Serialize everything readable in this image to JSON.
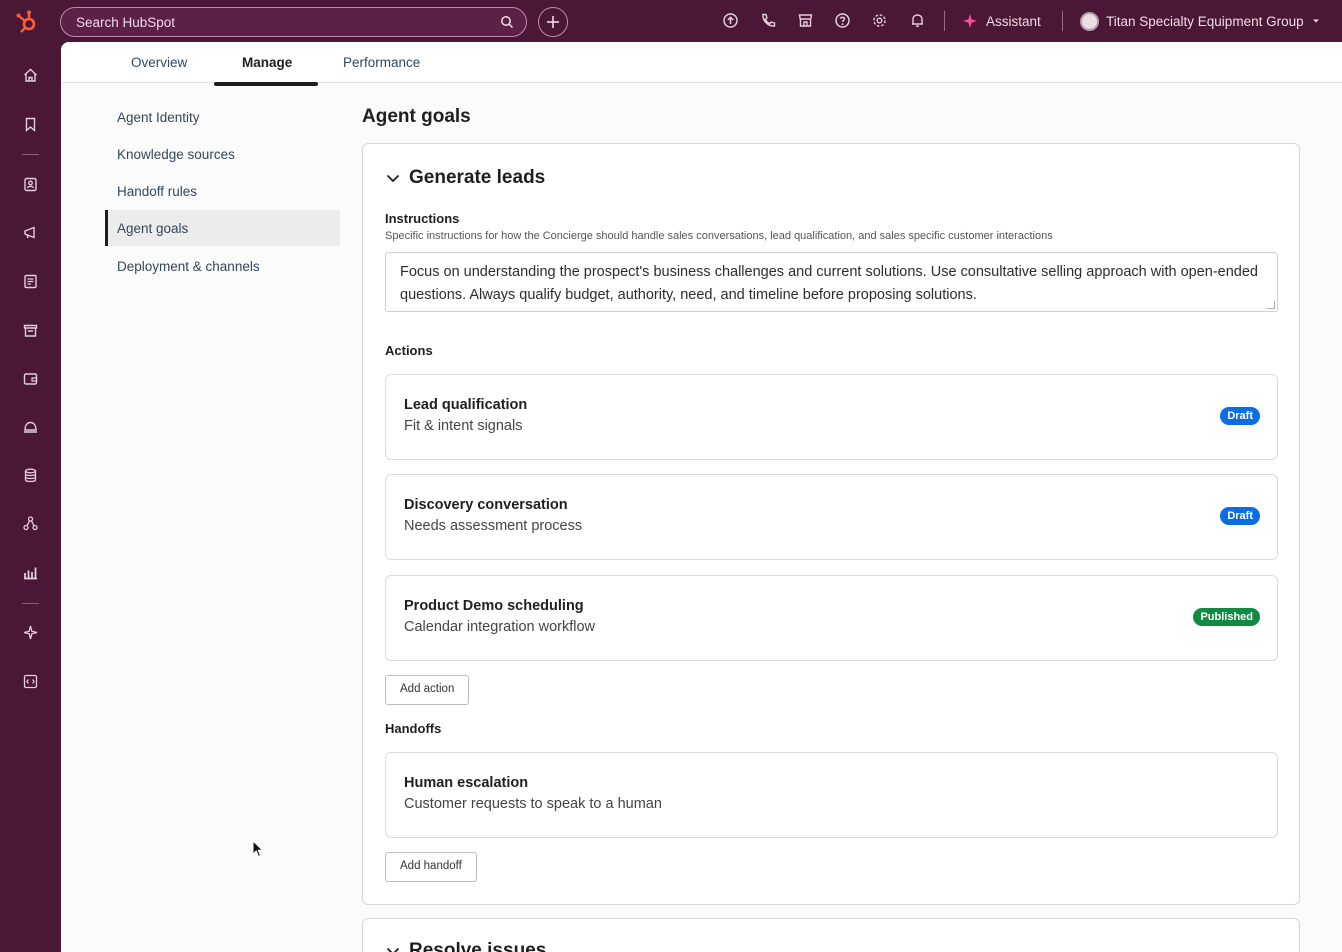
{
  "topbar": {
    "search_placeholder": "Search HubSpot",
    "assistant_label": "Assistant",
    "account_name": "Titan Specialty Equipment Group",
    "icons": [
      "upgrade-icon",
      "phone-icon",
      "marketplace-icon",
      "help-icon",
      "settings-icon",
      "notifications-icon"
    ]
  },
  "tabs": [
    {
      "label": "Overview",
      "active": false
    },
    {
      "label": "Manage",
      "active": true
    },
    {
      "label": "Performance",
      "active": false
    }
  ],
  "sidebar": {
    "items": [
      {
        "label": "Agent Identity",
        "active": false
      },
      {
        "label": "Knowledge sources",
        "active": false
      },
      {
        "label": "Handoff rules",
        "active": false
      },
      {
        "label": "Agent goals",
        "active": true
      },
      {
        "label": "Deployment & channels",
        "active": false
      }
    ]
  },
  "page": {
    "title": "Agent goals"
  },
  "goal": {
    "title": "Generate leads",
    "instructions_label": "Instructions",
    "instructions_help": "Specific instructions for how the Concierge should handle sales conversations, lead qualification, and sales specific customer interactions",
    "instructions_value": "Focus on understanding the prospect's business challenges and current solutions. Use consultative selling approach with open-ended questions. Always qualify budget, authority, need, and timeline before proposing solutions.",
    "actions_label": "Actions",
    "actions": [
      {
        "title": "Lead qualification",
        "subtitle": "Fit & intent signals",
        "status": "Draft"
      },
      {
        "title": "Discovery conversation",
        "subtitle": "Needs assessment process",
        "status": "Draft"
      },
      {
        "title": "Product Demo scheduling",
        "subtitle": "Calendar integration workflow",
        "status": "Published"
      }
    ],
    "add_action_label": "Add action",
    "handoffs_label": "Handoffs",
    "handoffs": [
      {
        "title": "Human escalation",
        "subtitle": "Customer requests to speak to a human"
      }
    ],
    "add_handoff_label": "Add handoff"
  },
  "goal2": {
    "title": "Resolve issues"
  },
  "colors": {
    "chrome": "#4a1836",
    "brand": "#ff5c35",
    "draft": "#0b6ee0",
    "published": "#128a43",
    "assistant_spark": "#ff4fa3"
  }
}
